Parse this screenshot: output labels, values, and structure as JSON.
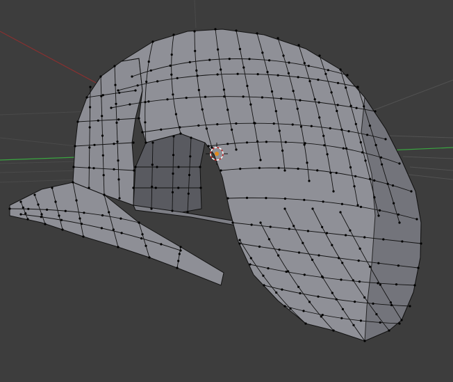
{
  "viewport": {
    "background": "#3d3d3d",
    "mesh_face_color": "#8e8f96",
    "mesh_face_dark": "#6b6c73",
    "mesh_face_inner": "#595a60",
    "wire_color": "#111111",
    "x_axis_color": "#8a3030",
    "y_axis_color": "#3aa640",
    "icons": {
      "cursor": "3d-cursor-icon"
    }
  }
}
